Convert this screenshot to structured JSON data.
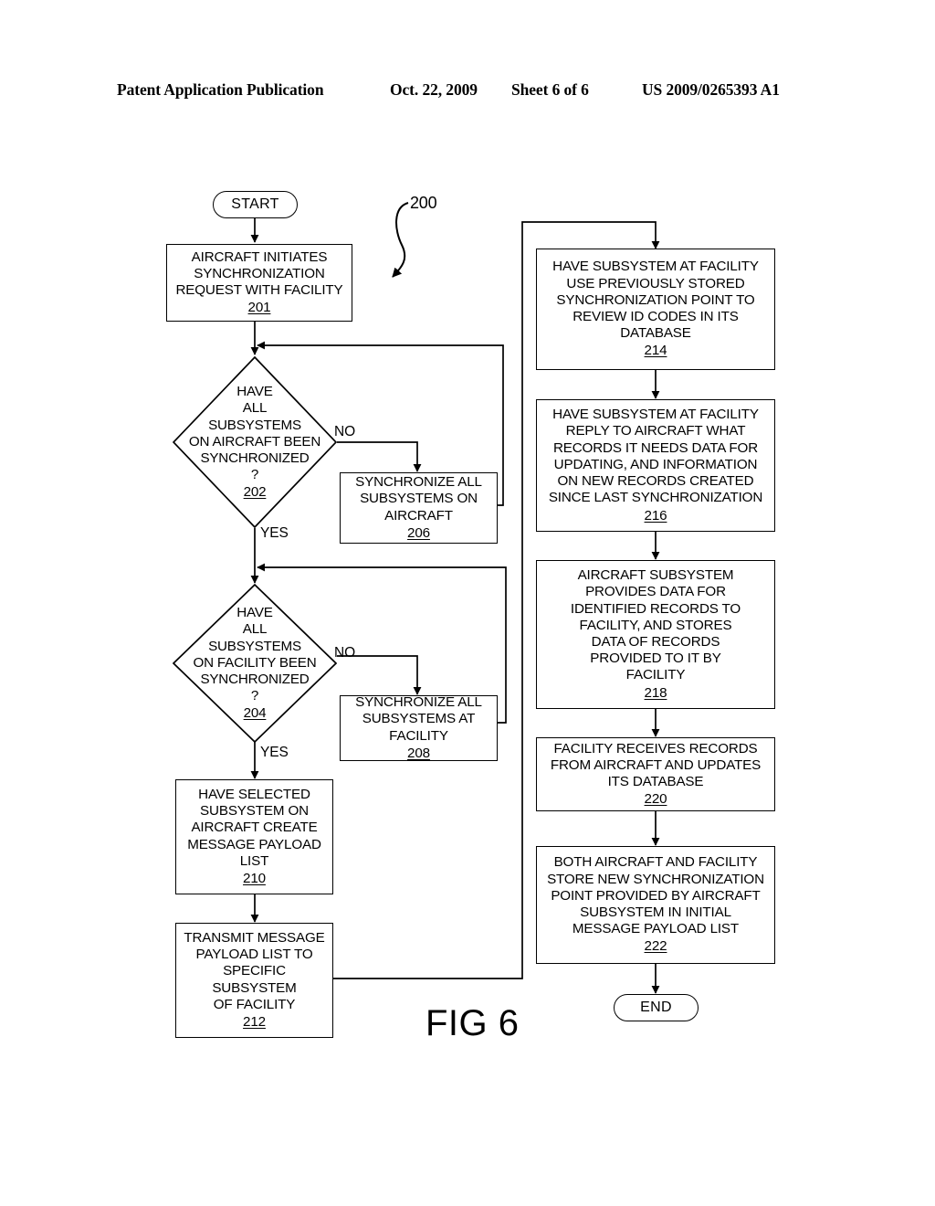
{
  "header": {
    "publication": "Patent Application Publication",
    "date": "Oct. 22, 2009",
    "sheet": "Sheet 6 of 6",
    "patent_number": "US 2009/0265393 A1"
  },
  "figure": {
    "caption": "FIG 6",
    "diagram_reference": "200"
  },
  "nodes": {
    "start": {
      "label": "START"
    },
    "end": {
      "label": "END"
    },
    "n201": {
      "text": "AIRCRAFT INITIATES\nSYNCHRONIZATION\nREQUEST WITH FACILITY",
      "ref": "201"
    },
    "n202": {
      "text": "HAVE\nALL\nSUBSYSTEMS\nON AIRCRAFT BEEN\nSYNCHRONIZED\n?",
      "ref": "202"
    },
    "n204": {
      "text": "HAVE\nALL\nSUBSYSTEMS\nON FACILITY BEEN\nSYNCHRONIZED\n?",
      "ref": "204"
    },
    "n206": {
      "text": "SYNCHRONIZE ALL\nSUBSYSTEMS ON\nAIRCRAFT",
      "ref": "206"
    },
    "n208": {
      "text": "SYNCHRONIZE ALL\nSUBSYSTEMS AT\nFACILITY",
      "ref": "208"
    },
    "n210": {
      "text": "HAVE SELECTED\nSUBSYSTEM ON\nAIRCRAFT CREATE\nMESSAGE PAYLOAD\nLIST",
      "ref": "210"
    },
    "n212": {
      "text": "TRANSMIT MESSAGE\nPAYLOAD LIST TO\nSPECIFIC\nSUBSYSTEM\nOF FACILITY",
      "ref": "212"
    },
    "n214": {
      "text": "HAVE SUBSYSTEM AT FACILITY\nUSE PREVIOUSLY STORED\nSYNCHRONIZATION POINT TO\nREVIEW ID CODES IN ITS\nDATABASE",
      "ref": "214"
    },
    "n216": {
      "text": "HAVE SUBSYSTEM AT FACILITY\nREPLY TO AIRCRAFT WHAT\nRECORDS IT NEEDS DATA FOR\nUPDATING, AND INFORMATION\nON NEW RECORDS CREATED\nSINCE LAST SYNCHRONIZATION",
      "ref": "216"
    },
    "n218": {
      "text": "AIRCRAFT SUBSYSTEM\nPROVIDES DATA FOR\nIDENTIFIED RECORDS TO\nFACILITY, AND STORES\nDATA OF RECORDS\nPROVIDED TO IT BY\nFACILITY",
      "ref": "218"
    },
    "n220": {
      "text": "FACILITY RECEIVES RECORDS\nFROM AIRCRAFT AND UPDATES\nITS DATABASE",
      "ref": "220"
    },
    "n222": {
      "text": "BOTH AIRCRAFT AND FACILITY\nSTORE NEW SYNCHRONIZATION\nPOINT PROVIDED BY AIRCRAFT\nSUBSYSTEM IN INITIAL\nMESSAGE PAYLOAD LIST",
      "ref": "222"
    }
  },
  "edge_labels": {
    "no_202": "NO",
    "yes_202": "YES",
    "no_204": "NO",
    "yes_204": "YES"
  },
  "colors": {
    "ink": "#000000",
    "paper": "#ffffff"
  }
}
